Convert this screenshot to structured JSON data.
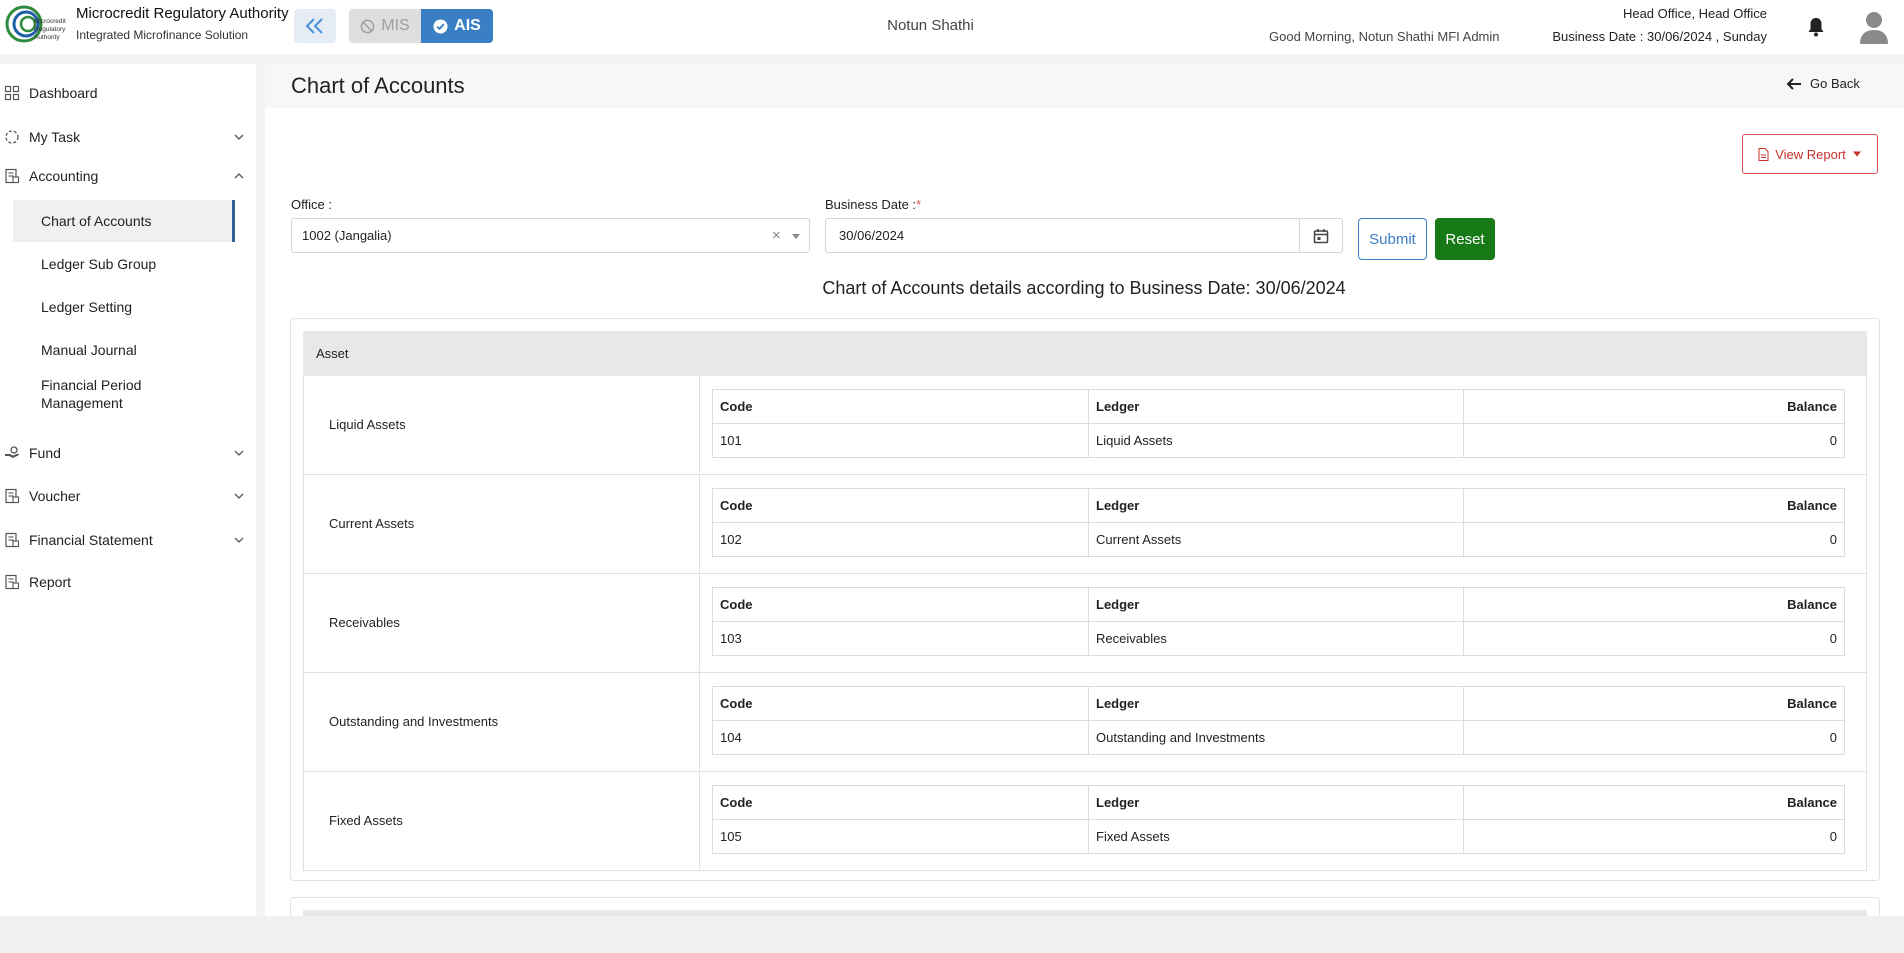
{
  "header": {
    "brand_title": "Microcredit Regulatory Authority",
    "brand_subtitle": "Integrated Microfinance Solution",
    "logo_text": "Microcredit Regulatory Authority",
    "toggle_mis": "MIS",
    "toggle_ais": "AIS",
    "center_title": "Notun Shathi",
    "greeting": "Good Morning, Notun Shathi MFI Admin",
    "office": "Head Office, Head Office",
    "business_date": "Business Date : 30/06/2024 , Sunday",
    "accent_color": "#3a7fc4"
  },
  "sidebar": {
    "dashboard": "Dashboard",
    "my_task": "My Task",
    "accounting": "Accounting",
    "accounting_items": [
      "Chart of Accounts",
      "Ledger Sub Group",
      "Ledger Setting",
      "Manual Journal",
      "Financial Period Management"
    ],
    "fund": "Fund",
    "voucher": "Voucher",
    "financial_statement": "Financial Statement",
    "report": "Report"
  },
  "page": {
    "title": "Chart of Accounts",
    "go_back": "Go Back",
    "view_report": "View Report",
    "office_label": "Office :",
    "office_value": "1002 (Jangalia)",
    "business_date_label": "Business Date :",
    "business_date_required": "*",
    "business_date_value": "30/06/2024",
    "submit": "Submit",
    "reset": "Reset",
    "details_title": "Chart of Accounts details according to Business Date: 30/06/2024"
  },
  "table_headers": {
    "code": "Code",
    "ledger": "Ledger",
    "balance": "Balance"
  },
  "groups": [
    {
      "name": "Asset",
      "accounts": [
        {
          "name": "Liquid Assets",
          "code": "101",
          "ledger": "Liquid Assets",
          "balance": "0"
        },
        {
          "name": "Current Assets",
          "code": "102",
          "ledger": "Current Assets",
          "balance": "0"
        },
        {
          "name": "Receivables",
          "code": "103",
          "ledger": "Receivables",
          "balance": "0"
        },
        {
          "name": "Outstanding and Investments",
          "code": "104",
          "ledger": "Outstanding and Investments",
          "balance": "0"
        },
        {
          "name": "Fixed Assets",
          "code": "105",
          "ledger": "Fixed Assets",
          "balance": "0"
        }
      ]
    }
  ]
}
